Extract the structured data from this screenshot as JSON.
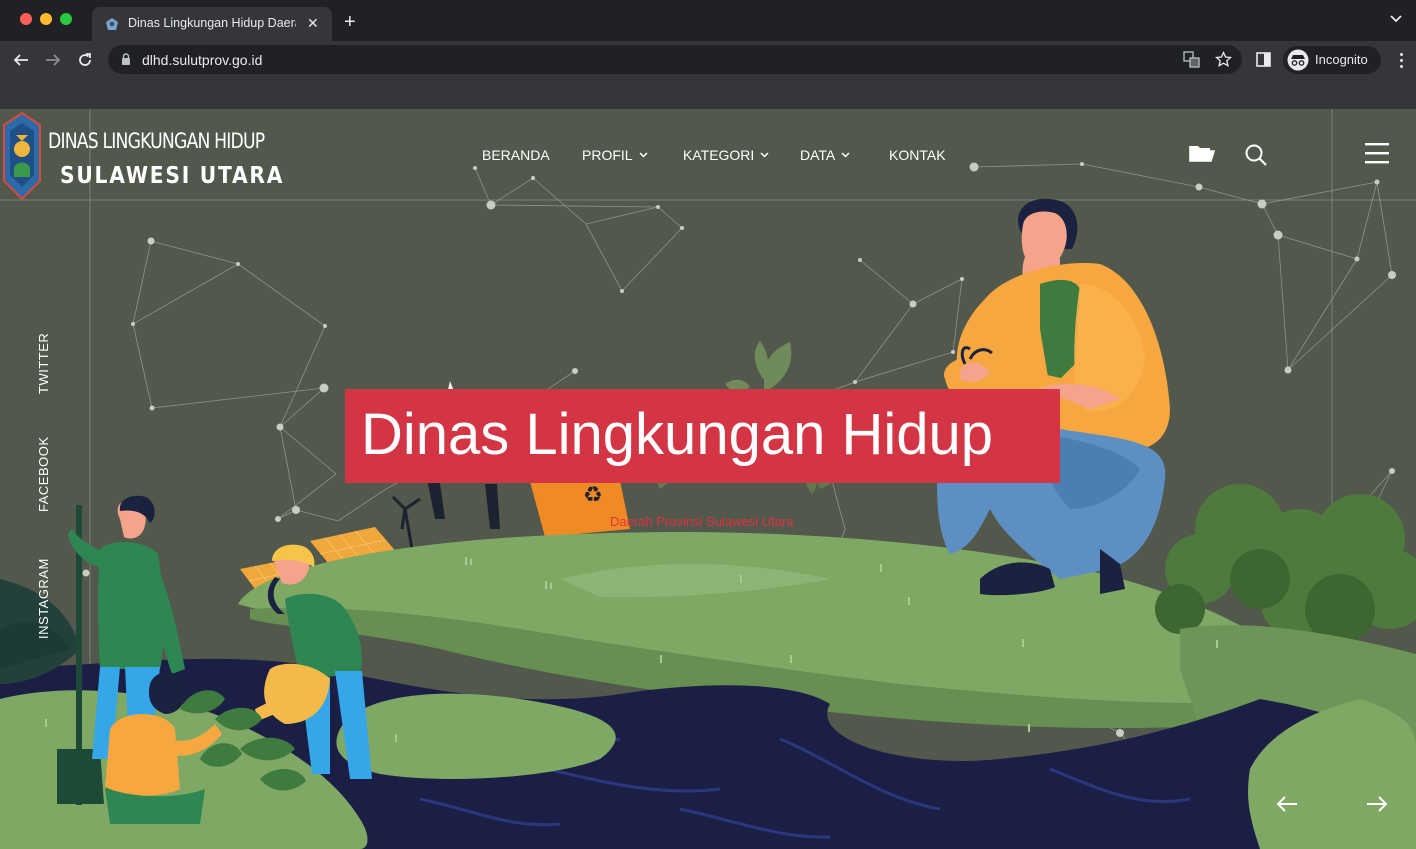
{
  "browser": {
    "tab_title": "Dinas Lingkungan Hidup Daera",
    "url": "dlhd.sulutprov.go.id",
    "incognito_label": "Incognito",
    "new_tab_glyph": "+",
    "close_tab_glyph": "✕"
  },
  "site": {
    "logo_line1": "DINAS LINGKUNGAN HIDUP",
    "logo_line2": "SULAWESI UTARA",
    "nav": [
      {
        "label": "BERANDA",
        "has_dropdown": false
      },
      {
        "label": "PROFIL",
        "has_dropdown": true
      },
      {
        "label": "KATEGORI",
        "has_dropdown": true
      },
      {
        "label": "DATA",
        "has_dropdown": true
      },
      {
        "label": "KONTAK",
        "has_dropdown": false
      }
    ],
    "social": [
      "TWITTER",
      "FACEBOOK",
      "INSTAGRAM"
    ],
    "hero_title": "Dinas Lingkungan Hidup",
    "hero_subtitle": "Daerah Provinsi Sulawesi Utara",
    "icons": [
      "folder-icon",
      "search-icon",
      "menu-icon",
      "arrow-left-icon",
      "arrow-right-icon"
    ]
  },
  "colors": {
    "hero_box": "#d33545",
    "page_bg": "#52584c",
    "subtitle": "#e0323f"
  }
}
